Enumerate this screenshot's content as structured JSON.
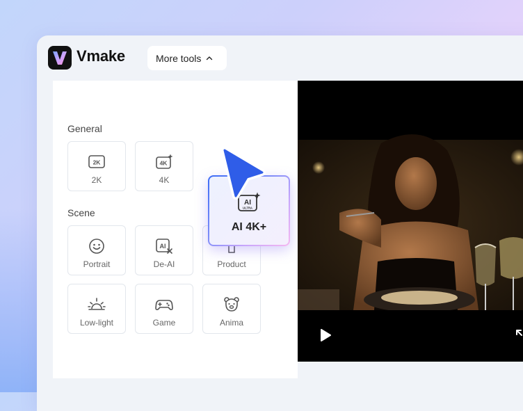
{
  "app": {
    "brand": "Vmake",
    "more_tools_label": "More tools"
  },
  "panel": {
    "general_title": "General",
    "general_tiles": [
      {
        "label": "2K",
        "icon": "2k-icon"
      },
      {
        "label": "4K",
        "icon": "4k-sparkle-icon"
      }
    ],
    "featured_tile": {
      "label": "AI 4K+",
      "icon": "ai-ultra-icon"
    },
    "scene_title": "Scene",
    "scene_tiles": [
      {
        "label": "Portrait",
        "icon": "smiley-icon"
      },
      {
        "label": "De-AI",
        "icon": "de-ai-icon"
      },
      {
        "label": "Product",
        "icon": "product-icon"
      },
      {
        "label": "Low-light",
        "icon": "sunrise-icon"
      },
      {
        "label": "Game",
        "icon": "gamepad-icon"
      },
      {
        "label": "Anima",
        "icon": "bear-icon"
      }
    ]
  },
  "colors": {
    "accent": "#3c6cf6",
    "cursor": "#2f5de8"
  }
}
